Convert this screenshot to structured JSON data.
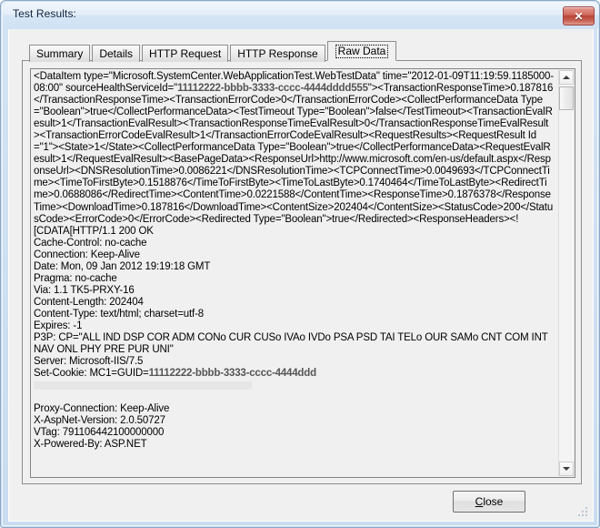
{
  "window": {
    "title": "Test Results:",
    "close_icon": "close-x-icon",
    "close_glyph": "✕"
  },
  "tabs": [
    {
      "label": "Summary",
      "active": false
    },
    {
      "label": "Details",
      "active": false
    },
    {
      "label": "HTTP Request",
      "active": false
    },
    {
      "label": "HTTP Response",
      "active": false
    },
    {
      "label": "Raw Data",
      "active": true
    }
  ],
  "raw_data": {
    "xml_part": "<DataItem type=\"Microsoft.SystemCenter.WebApplicationTest.WebTestData\" time=\"2012-01-09T11:19:59.1185000-08:00\" sourceHealthServiceId=\"",
    "guid_1": "11112222-bbbb-3333-cccc-4444dddd555",
    "xml_part_2": "\"><TransactionResponseTime>0.187816</TransactionResponseTime><TransactionErrorCode>0</TransactionErrorCode><CollectPerformanceData Type=\"Boolean\">true</CollectPerformanceData><TestTimeout Type=\"Boolean\">false</TestTimeout><TransactionEvalResult>1</TransactionEvalResult><TransactionResponseTimeEvalResult>0</TransactionResponseTimeEvalResult><TransactionErrorCodeEvalResult>1</TransactionErrorCodeEvalResult><RequestResults><RequestResult Id=\"1\"><State>1</State><CollectPerformanceData Type=\"Boolean\">true</CollectPerformanceData><RequestEvalResult>1</RequestEvalResult><BasePageData><ResponseUrl>http://www.microsoft.com/en-us/default.aspx</ResponseUrl><DNSResolutionTime>0.0086221</DNSResolutionTime><TCPConnectTime>0.0049693</TCPConnectTime><TimeToFirstByte>0.1518876</TimeToFirstByte><TimeToLastByte>0.1740464</TimeToLastByte><RedirectTime>0.0688086</RedirectTime><ContentTime>0.0221588</ContentTime><ResponseTime>0.1876378</ResponseTime><DownloadTime>0.187816</DownloadTime><ContentSize>202404</ContentSize><StatusCode>200</StatusCode><ErrorCode>0</ErrorCode><Redirected Type=\"Boolean\">true</Redirected><ResponseHeaders><!",
    "headers": [
      "[CDATA[HTTP/1.1 200 OK",
      "Cache-Control: no-cache",
      "Connection: Keep-Alive",
      "Date: Mon, 09 Jan 2012 19:19:18 GMT",
      "Pragma: no-cache",
      "Via: 1.1 TK5-PRXY-16",
      "Content-Length: 202404",
      "Content-Type: text/html; charset=utf-8",
      "Expires: -1",
      "P3P: CP=\"ALL IND DSP COR ADM CONo CUR CUSo IVAo IVDo PSA PSD TAI TELo OUR SAMo CNT COM INT NAV ONL PHY PRE PUR UNI\"",
      "Server: Microsoft-IIS/7.5"
    ],
    "set_cookie_label": "Set-Cookie: MC1=GUID=",
    "guid_2": "11112222-bbbb-3333-cccc-4444ddd",
    "headers_tail": [
      "Proxy-Connection: Keep-Alive",
      "X-AspNet-Version: 2.0.50727",
      "VTag: 791106442100000000",
      "X-Powered-By: ASP.NET"
    ]
  },
  "scrollbar": {
    "up_icon": "scroll-up-arrow-icon",
    "down_icon": "scroll-down-arrow-icon"
  },
  "footer": {
    "close_accel": "C",
    "close_rest": "lose"
  }
}
